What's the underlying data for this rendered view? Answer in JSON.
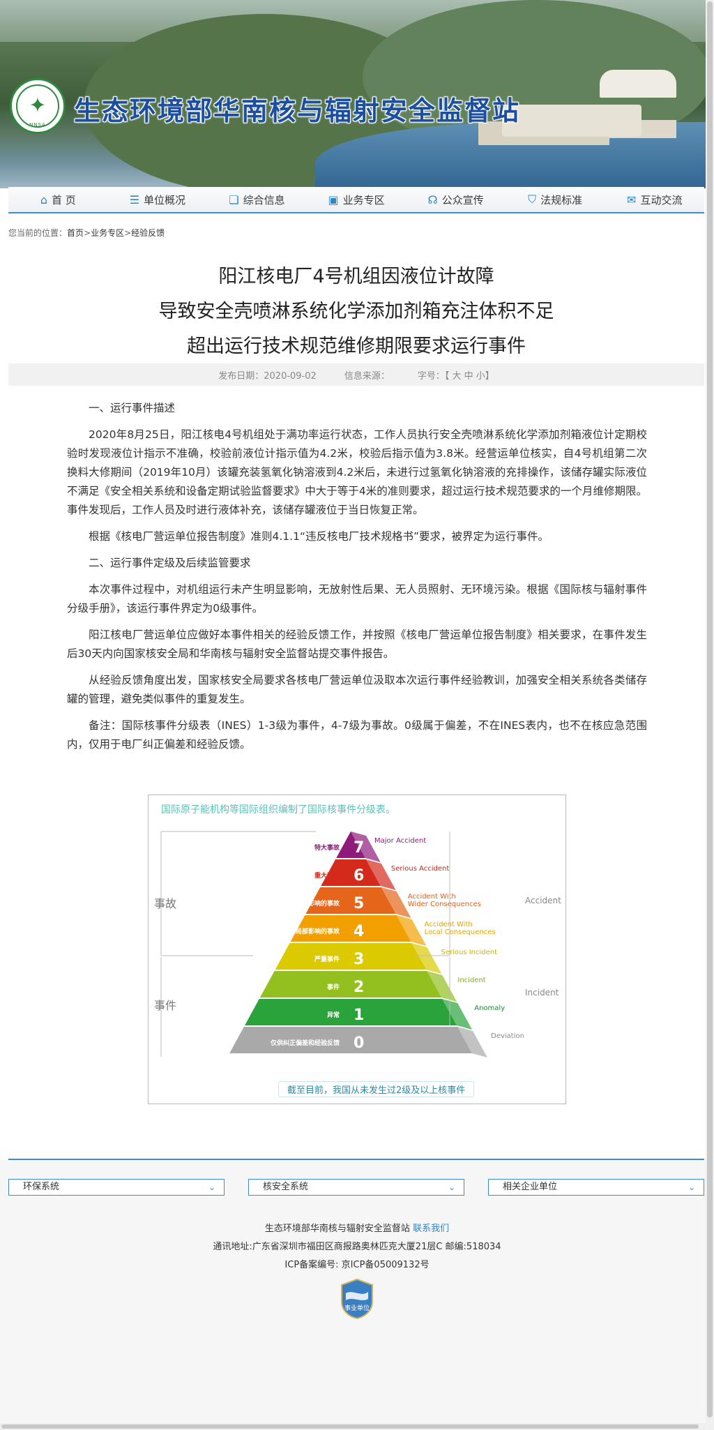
{
  "site": {
    "title": "生态环境部华南核与辐射安全监督站",
    "logo_text": "NNSA",
    "logo_symbol": "✦"
  },
  "nav": [
    {
      "label": "首 页",
      "icon": "home-icon",
      "glyph": "⌂"
    },
    {
      "label": "单位概况",
      "icon": "list-icon",
      "glyph": "☰"
    },
    {
      "label": "综合信息",
      "icon": "book-icon",
      "glyph": "❏"
    },
    {
      "label": "业务专区",
      "icon": "briefcase-icon",
      "glyph": "▣"
    },
    {
      "label": "公众宣传",
      "icon": "chat-icon",
      "glyph": "☊"
    },
    {
      "label": "法规标准",
      "icon": "shield-icon",
      "glyph": "⛉"
    },
    {
      "label": "互动交流",
      "icon": "message-icon",
      "glyph": "✉"
    }
  ],
  "breadcrumb": {
    "prefix": "您当前的位置：",
    "home": "首页",
    "sep1": ">",
    "section": "业务专区",
    "sep2": ">",
    "page": "经验反馈"
  },
  "article": {
    "title_lines": [
      "阳江核电厂4号机组因液位计故障",
      "导致安全壳喷淋系统化学添加剂箱充注体积不足",
      "超出运行技术规范维修期限要求运行事件"
    ],
    "publish_date": "发布日期：2020-09-02",
    "source": "信息来源：",
    "font_size_label": "字号：【 大 中 小】",
    "paragraphs": [
      {
        "text": "一、运行事件描述"
      },
      {
        "text": "2020年8月25日，阳江核电4号机组处于满功率运行状态，工作人员执行安全壳喷淋系统化学添加剂箱液位计定期校验时发现液位计指示不准确，校验前液位计指示值为4.2米，校验后指示值为3.8米。经营运单位核实，自4号机组第二次换料大修期间（2019年10月）该罐充装氢氧化钠溶液到4.2米后，未进行过氢氧化钠溶液的充排操作，该储存罐实际液位不满足《安全相关系统和设备定期试验监督要求》中大于等于4米的准则要求，超过运行技术规范要求的一个月维修期限。事件发现后，工作人员及时进行液体补充，该储存罐液位于当日恢复正常。"
      },
      {
        "text": "根据《核电厂营运单位报告制度》准则4.1.1“违反核电厂技术规格书”要求，被界定为运行事件。"
      },
      {
        "text": "二、运行事件定级及后续监管要求"
      },
      {
        "text": "本次事件过程中，对机组运行未产生明显影响，无放射性后果、无人员照射、无环境污染。根据《国际核与辐射事件分级手册》，该运行事件界定为0级事件。"
      },
      {
        "text": "阳江核电厂营运单位应做好本事件相关的经验反馈工作，并按照《核电厂营运单位报告制度》相关要求，在事件发生后30天内向国家核安全局和华南核与辐射安全监督站提交事件报告。"
      },
      {
        "text": "从经验反馈角度出发，国家核安全局要求各核电厂营运单位汲取本次运行事件经验教训，加强安全相关系统各类储存罐的管理，避免类似事件的重复发生。"
      },
      {
        "text": "备注：国际核事件分级表（INES）1-3级为事件，4-7级为事故。0级属于偏差，不在INES表内，也不在核应急范围内，仅用于电厂纠正偏差和经验反馈。"
      }
    ]
  },
  "ines_figure": {
    "heading": "国际原子能机构等国际组织编制了国际核事件分级表。",
    "left_accident": "事故",
    "left_incident": "事件",
    "right_accident": "Accident",
    "right_incident": "Incident",
    "note": "截至目前，我国从未发生过2级及以上核事件",
    "levels": [
      {
        "level": "7",
        "cn": "特大事故",
        "en": "Major Accident",
        "color": "#8e1b7a",
        "en_color": "#8e1b7a"
      },
      {
        "level": "6",
        "cn": "重大事故",
        "en": "Serious Accident",
        "color": "#d42a1c",
        "en_color": "#c8281c"
      },
      {
        "level": "5",
        "cn": "具有广泛影响的事故",
        "en": "Accident With\nWider Consequences",
        "color": "#e5661a",
        "en_color": "#e0601a"
      },
      {
        "level": "4",
        "cn": "具有局部影响的事故",
        "en": "Accident With\nLocal Consequences",
        "color": "#f2a000",
        "en_color": "#e9a300"
      },
      {
        "level": "3",
        "cn": "严重事件",
        "en": "Serious Incident",
        "color": "#dcca00",
        "en_color": "#c9b800"
      },
      {
        "level": "2",
        "cn": "事件",
        "en": "Incident",
        "color": "#93bf1f",
        "en_color": "#7fae16"
      },
      {
        "level": "1",
        "cn": "异常",
        "en": "Anomaly",
        "color": "#2aa43a",
        "en_color": "#1d8a33"
      },
      {
        "level": "0",
        "cn": "仅供纠正偏差和经验反馈",
        "en": "Deviation",
        "color": "#a9a9a9",
        "en_color": "#8a8a8a"
      }
    ]
  },
  "footer": {
    "selects": [
      "环保系统",
      "核安全系统",
      "相关企业单位"
    ],
    "org": "生态环境部华南核与辐射安全监督站",
    "contact": "联系我们",
    "address": "通讯地址:广东省深圳市福田区商报路奥林匹克大厦21层C 邮编:518034",
    "icp": "ICP备案编号: 京ICP备05009132号",
    "badge_text": "事业单位"
  },
  "colors": {
    "brand_blue": "#1c4fa0",
    "nav_accent": "#3b8fc8",
    "link": "#2e86c9"
  }
}
